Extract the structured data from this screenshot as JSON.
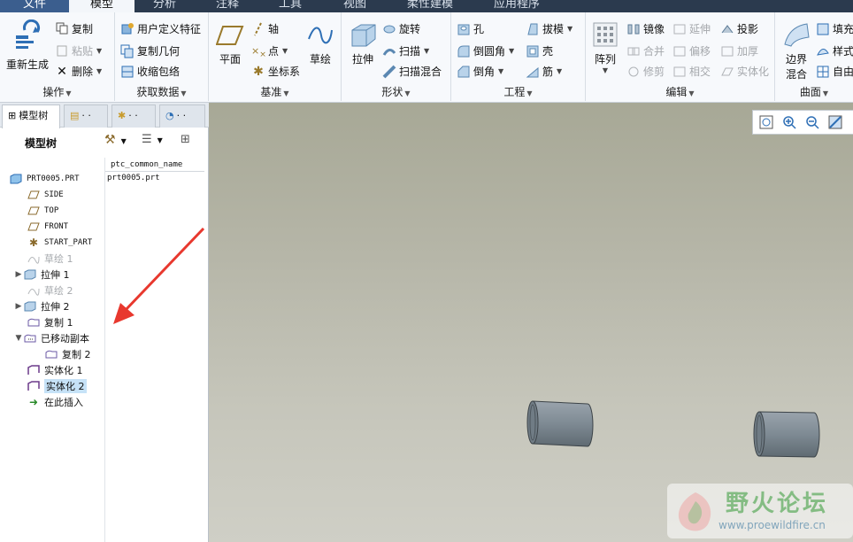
{
  "tabs": [
    {
      "label": "文件"
    },
    {
      "label": "模型"
    },
    {
      "label": "分析"
    },
    {
      "label": "注释"
    },
    {
      "label": "工具"
    },
    {
      "label": "视图"
    },
    {
      "label": "柔性建模"
    },
    {
      "label": "应用程序"
    }
  ],
  "ribbon": {
    "operations": {
      "label": "操作",
      "regenerate": "重新生成",
      "copy": "复制",
      "paste": "粘贴",
      "delete": "删除"
    },
    "get_data": {
      "label": "获取数据",
      "udf": "用户定义特征",
      "copy_geom": "复制几何",
      "shrinkwrap": "收缩包络"
    },
    "datum": {
      "label": "基准",
      "plane": "平面",
      "axis": "轴",
      "point": "点",
      "csys": "坐标系",
      "sketch": "草绘"
    },
    "shapes": {
      "label": "形状",
      "extrude": "拉伸",
      "revolve": "旋转",
      "sweep": "扫描",
      "swept_blend": "扫描混合"
    },
    "engineering": {
      "label": "工程",
      "hole": "孔",
      "round": "倒圆角",
      "chamfer": "倒角",
      "draft": "拔模",
      "shell": "壳",
      "rib": "筋"
    },
    "editing": {
      "label": "编辑",
      "pattern": "阵列",
      "mirror": "镜像",
      "extend": "延伸",
      "project": "投影",
      "merge": "合并",
      "offset": "偏移",
      "thicken": "加厚",
      "trim": "修剪",
      "intersect": "相交",
      "solidify": "实体化"
    },
    "surfaces": {
      "label": "曲面",
      "boundary_blend_l1": "边界",
      "boundary_blend_l2": "混合",
      "fill": "填充",
      "style": "样式",
      "freestyle": "自由"
    }
  },
  "left_panel": {
    "tabs": [
      {
        "label": "模型树"
      },
      {
        "label": "· ·"
      },
      {
        "label": "· ·"
      },
      {
        "label": "· ·"
      }
    ],
    "title": "模型树",
    "column_header": "ptc_common_name",
    "column_value": "prt0005.prt",
    "tree": [
      {
        "label": "PRT0005.PRT"
      },
      {
        "label": "SIDE"
      },
      {
        "label": "TOP"
      },
      {
        "label": "FRONT"
      },
      {
        "label": "START_PART"
      },
      {
        "label": "草绘 1"
      },
      {
        "label": "拉伸 1"
      },
      {
        "label": "草绘 2"
      },
      {
        "label": "拉伸 2"
      },
      {
        "label": "复制 1"
      },
      {
        "label": "已移动副本"
      },
      {
        "label": "复制 2"
      },
      {
        "label": "实体化 1"
      },
      {
        "label": "实体化 2"
      },
      {
        "label": "在此插入"
      }
    ]
  },
  "watermark": {
    "title": "野火论坛",
    "url": "www.proewildfire.cn"
  },
  "colors": {
    "accent": "#3b5e8e",
    "selection": "#c6e2f7",
    "arrow": "#e8382e",
    "solid": "#7e8a93"
  }
}
